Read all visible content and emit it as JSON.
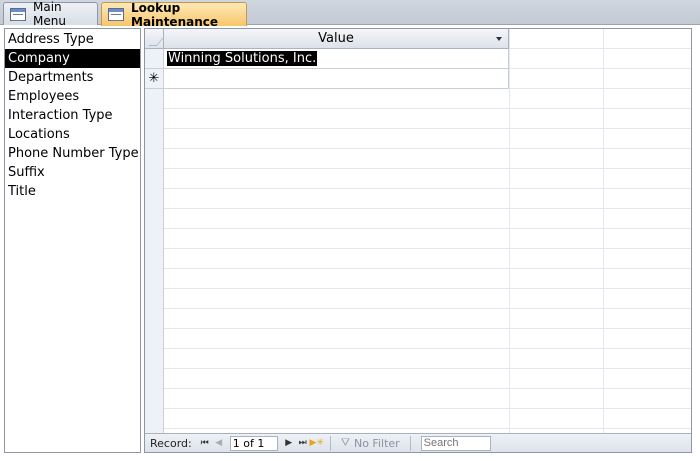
{
  "tabs": [
    {
      "label": "Main Menu",
      "icon": "form-icon",
      "active": false
    },
    {
      "label": "Lookup Maintenance",
      "icon": "form-icon",
      "active": true
    }
  ],
  "lookup_list": {
    "items": [
      {
        "label": "Address Type"
      },
      {
        "label": "Company"
      },
      {
        "label": "Departments"
      },
      {
        "label": "Employees"
      },
      {
        "label": "Interaction Type"
      },
      {
        "label": "Locations"
      },
      {
        "label": "Phone Number Type"
      },
      {
        "label": "Suffix"
      },
      {
        "label": "Title"
      }
    ],
    "selected": "Company"
  },
  "datasheet": {
    "column_header": "Value",
    "rows": [
      {
        "value": "Winning Solutions, Inc."
      }
    ],
    "new_row_marker": "✳"
  },
  "navigation": {
    "record_label": "Record:",
    "position": "1 of 1",
    "filter_label": "No Filter",
    "search_placeholder": "Search",
    "first_icon": "⏮",
    "prev_icon": "◀",
    "next_icon": "▶",
    "last_icon": "⏭",
    "new_icon": "▶✳"
  },
  "colors": {
    "active_tab": "#f6c66a",
    "selection": "#000000"
  }
}
